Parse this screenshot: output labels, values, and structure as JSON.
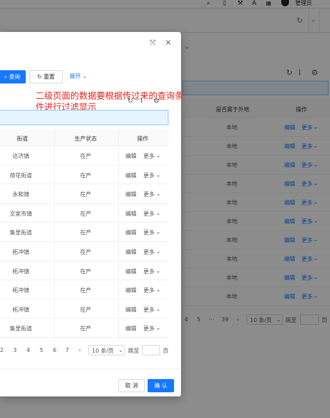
{
  "topbar": {
    "search_icon": "⌕",
    "doc_icon": "▯",
    "tool_icon": "⚒",
    "font_icon": "A",
    "user_name": "管理员"
  },
  "background": {
    "columns": [
      "是否属于外地",
      "操作"
    ],
    "rows": [
      {
        "local": "本地",
        "edit": "编辑",
        "more": "更多"
      },
      {
        "local": "本地",
        "edit": "编辑",
        "more": "更多"
      },
      {
        "local": "本地",
        "edit": "编辑",
        "more": "更多"
      },
      {
        "local": "本地",
        "edit": "编辑",
        "more": "更多"
      },
      {
        "local": "本地",
        "edit": "编辑",
        "more": "更多"
      },
      {
        "local": "本地",
        "edit": "编辑",
        "more": "更多"
      },
      {
        "local": "本地",
        "edit": "编辑",
        "more": "更多"
      },
      {
        "local": "本地",
        "edit": "编辑",
        "more": "更多"
      },
      {
        "local": "本地",
        "edit": "编辑",
        "more": "更多"
      },
      {
        "local": "本地",
        "edit": "编辑",
        "more": "更多"
      }
    ],
    "pager": {
      "p4": "4",
      "p5": "5",
      "ellipsis": "···",
      "last": "39",
      "next": "›",
      "size": "10 条/页",
      "jump": "跳至",
      "page": "页"
    }
  },
  "modal": {
    "search_button": "查询",
    "reset_button": "重置",
    "expand_label": "展开",
    "annotation": "二级页面的数据要根据传过来的查询条件进行过滤显示",
    "columns": {
      "street": "街道",
      "status": "生产状态",
      "action": "操作"
    },
    "rows": [
      {
        "street": "达济镇",
        "status": "在产",
        "edit": "编辑",
        "more": "更多"
      },
      {
        "street": "荷花街道",
        "status": "在产",
        "edit": "编辑",
        "more": "更多"
      },
      {
        "street": "永和镇",
        "status": "在产",
        "edit": "编辑",
        "more": "更多"
      },
      {
        "street": "文家市镇",
        "status": "在产",
        "edit": "编辑",
        "more": "更多"
      },
      {
        "street": "集里街道",
        "status": "在产",
        "edit": "编辑",
        "more": "更多"
      },
      {
        "street": "柘冲镇",
        "status": "在产",
        "edit": "编辑",
        "more": "更多"
      },
      {
        "street": "柘冲镇",
        "status": "在产",
        "edit": "编辑",
        "more": "更多"
      },
      {
        "street": "柘冲镇",
        "status": "在产",
        "edit": "编辑",
        "more": "更多"
      },
      {
        "street": "柘冲镇",
        "status": "在产",
        "edit": "编辑",
        "more": "更多"
      },
      {
        "street": "集里街道",
        "status": "在产",
        "edit": "编辑",
        "more": "更多"
      }
    ],
    "pager": {
      "pages": [
        "2",
        "3",
        "4",
        "5",
        "6",
        "7"
      ],
      "next": "›",
      "size": "10 条/页",
      "jump": "跳至",
      "page": "页"
    },
    "cancel_button": "取 消",
    "confirm_button": "确 认"
  },
  "colors": {
    "primary": "#1677ff",
    "annotation": "#e8231a",
    "alert_bg": "#e6f4ff"
  }
}
